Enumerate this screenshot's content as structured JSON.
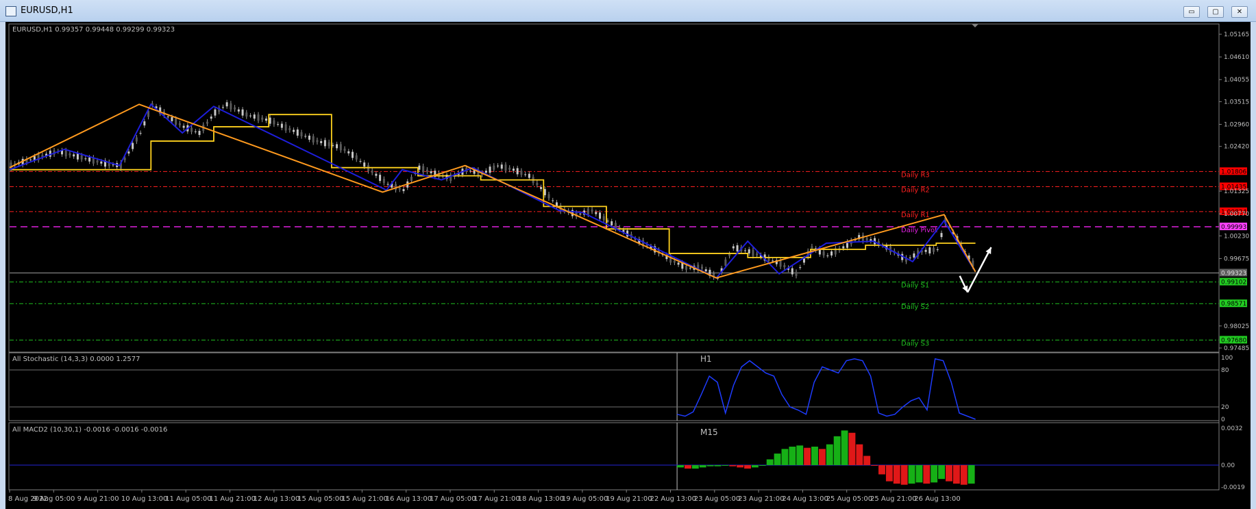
{
  "window": {
    "title": "EURUSD,H1",
    "buttons": {
      "minimize": "▭",
      "restore": "▢",
      "close": "✕"
    }
  },
  "main_header": "EURUSD,H1  0.99357 0.99448 0.99299 0.99323",
  "stoch_header": "All Stochastic (14,3,3) 0.0000 1.2577",
  "macd_header": "All MACD2 (10,30,1) -0.0016 -0.0016 -0.0016",
  "stoch_tf": "H1",
  "macd_tf": "M15",
  "colors": {
    "background": "#000000",
    "zigzag_blue": "#1e1edc",
    "zigzag_orange": "#ff9a1e",
    "step_yellow": "#ffd21e",
    "resistance": "#ff2020",
    "support": "#20c020",
    "pivot": "#e020e0",
    "stoch": "#1e3cff",
    "macd_up": "#16b016",
    "macd_down": "#e01818",
    "arrow": "#ffffff"
  },
  "chart_data": [
    {
      "type": "line",
      "symbol": "EURUSD",
      "timeframe": "H1",
      "ylim": [
        0.97485,
        1.05165
      ],
      "y_ticks": [
        "1.05165",
        "1.04610",
        "1.04055",
        "1.03515",
        "1.02960",
        "1.02420",
        "1.01325",
        "1.00770",
        "1.00230",
        "0.99675",
        "0.98025",
        "0.97485"
      ],
      "x_ticks": [
        "8 Aug 2022",
        "9 Aug 05:00",
        "9 Aug 21:00",
        "10 Aug 13:00",
        "11 Aug 05:00",
        "11 Aug 21:00",
        "12 Aug 13:00",
        "15 Aug 05:00",
        "15 Aug 21:00",
        "16 Aug 13:00",
        "17 Aug 05:00",
        "17 Aug 21:00",
        "18 Aug 13:00",
        "19 Aug 05:00",
        "19 Aug 21:00",
        "22 Aug 13:00",
        "23 Aug 05:00",
        "23 Aug 21:00",
        "24 Aug 13:00",
        "25 Aug 05:00",
        "25 Aug 21:00",
        "26 Aug 13:00"
      ],
      "levels": [
        {
          "name": "Daily R3",
          "value": 1.01806,
          "label": "1.01806",
          "kind": "resistance"
        },
        {
          "name": "Daily R2",
          "value": 1.01435,
          "label": "1.01435",
          "kind": "resistance"
        },
        {
          "name": "Daily R1",
          "value": 1.00824,
          "label": "1.00824",
          "kind": "resistance"
        },
        {
          "name": "Daily Pivot",
          "value": 1.00453,
          "label": "0.99993",
          "kind": "pivot"
        },
        {
          "name": "",
          "value": 0.99323,
          "label": "0.99323",
          "kind": "current"
        },
        {
          "name": "Daily S1",
          "value": 0.99102,
          "label": "0.99102",
          "kind": "support"
        },
        {
          "name": "Daily S2",
          "value": 0.98571,
          "label": "0.98571",
          "kind": "support"
        },
        {
          "name": "Daily S3",
          "value": 0.9768,
          "label": "0.97680",
          "kind": "support"
        }
      ],
      "price_path": [
        [
          0,
          1.0195
        ],
        [
          5,
          1.021
        ],
        [
          12,
          1.023
        ],
        [
          18,
          1.0215
        ],
        [
          24,
          1.02
        ],
        [
          28,
          1.0195
        ],
        [
          33,
          1.0275
        ],
        [
          36,
          1.0345
        ],
        [
          40,
          1.0315
        ],
        [
          44,
          1.029
        ],
        [
          48,
          1.0275
        ],
        [
          52,
          1.0325
        ],
        [
          55,
          1.0345
        ],
        [
          60,
          1.032
        ],
        [
          66,
          1.0305
        ],
        [
          72,
          1.028
        ],
        [
          78,
          1.0255
        ],
        [
          84,
          1.024
        ],
        [
          88,
          1.0215
        ],
        [
          92,
          1.018
        ],
        [
          96,
          1.015
        ],
        [
          100,
          1.0135
        ],
        [
          104,
          1.019
        ],
        [
          108,
          1.0175
        ],
        [
          112,
          1.0165
        ],
        [
          116,
          1.0185
        ],
        [
          120,
          1.0175
        ],
        [
          124,
          1.0195
        ],
        [
          128,
          1.0185
        ],
        [
          132,
          1.017
        ],
        [
          136,
          1.013
        ],
        [
          140,
          1.009
        ],
        [
          144,
          1.0075
        ],
        [
          148,
          1.0085
        ],
        [
          152,
          1.006
        ],
        [
          156,
          1.0035
        ],
        [
          160,
          1.001
        ],
        [
          164,
          0.999
        ],
        [
          168,
          0.9965
        ],
        [
          172,
          0.9945
        ],
        [
          176,
          0.9945
        ],
        [
          180,
          0.992
        ],
        [
          184,
          0.9995
        ],
        [
          188,
          0.9985
        ],
        [
          192,
          0.997
        ],
        [
          196,
          0.9955
        ],
        [
          200,
          0.993
        ],
        [
          204,
          0.9995
        ],
        [
          208,
          0.9975
        ],
        [
          212,
          0.9995
        ],
        [
          216,
          1.002
        ],
        [
          220,
          1.001
        ],
        [
          224,
          0.999
        ],
        [
          228,
          0.9965
        ],
        [
          232,
          0.9985
        ],
        [
          236,
          0.999
        ],
        [
          238,
          1.006
        ],
        [
          240,
          1.003
        ],
        [
          243,
          0.9985
        ],
        [
          246,
          0.994
        ]
      ],
      "zigzag_orange": [
        [
          0,
          1.019
        ],
        [
          33,
          1.0345
        ],
        [
          95,
          1.013
        ],
        [
          116,
          1.0195
        ],
        [
          180,
          0.992
        ],
        [
          238,
          1.0075
        ],
        [
          246,
          0.9935
        ]
      ],
      "zigzag_blue": [
        [
          0,
          1.0185
        ],
        [
          14,
          1.0235
        ],
        [
          28,
          1.0195
        ],
        [
          36,
          1.0345
        ],
        [
          44,
          1.0275
        ],
        [
          52,
          1.034
        ],
        [
          96,
          1.0135
        ],
        [
          100,
          1.0185
        ],
        [
          110,
          1.016
        ],
        [
          118,
          1.019
        ],
        [
          140,
          1.0085
        ],
        [
          146,
          1.008
        ],
        [
          180,
          0.992
        ],
        [
          188,
          1.001
        ],
        [
          196,
          0.993
        ],
        [
          208,
          1.0005
        ],
        [
          220,
          1.001
        ],
        [
          230,
          0.996
        ],
        [
          238,
          1.006
        ],
        [
          246,
          0.9935
        ]
      ],
      "step_yellow": [
        [
          0,
          1.0185
        ],
        [
          36,
          1.0185
        ],
        [
          36,
          1.0255
        ],
        [
          52,
          1.0255
        ],
        [
          52,
          1.029
        ],
        [
          66,
          1.029
        ],
        [
          66,
          1.032
        ],
        [
          82,
          1.032
        ],
        [
          82,
          1.019
        ],
        [
          104,
          1.019
        ],
        [
          104,
          1.017
        ],
        [
          120,
          1.017
        ],
        [
          120,
          1.016
        ],
        [
          136,
          1.016
        ],
        [
          136,
          1.0095
        ],
        [
          152,
          1.0095
        ],
        [
          152,
          1.004
        ],
        [
          168,
          1.004
        ],
        [
          168,
          0.998
        ],
        [
          188,
          0.998
        ],
        [
          188,
          0.997
        ],
        [
          204,
          0.997
        ],
        [
          204,
          0.999
        ],
        [
          218,
          0.999
        ],
        [
          218,
          1.0
        ],
        [
          236,
          1.0
        ],
        [
          236,
          1.0005
        ],
        [
          246,
          1.0005
        ]
      ],
      "forecast_arrows": [
        {
          "from": [
            242,
            0.9925
          ],
          "to": [
            244,
            0.9885
          ]
        },
        {
          "from": [
            244,
            0.9885
          ],
          "to": [
            250,
            0.9995
          ]
        }
      ]
    },
    {
      "type": "line",
      "name": "All Stochastic (14,3,3)",
      "ylim": [
        0,
        100
      ],
      "y_ticks": [
        "100",
        "80",
        "20",
        "0"
      ],
      "timeframe_label": "H1",
      "x_range": [
        170,
        246
      ],
      "values": [
        8,
        5,
        12,
        40,
        70,
        60,
        10,
        55,
        85,
        95,
        85,
        75,
        70,
        40,
        20,
        15,
        8,
        60,
        85,
        80,
        75,
        95,
        98,
        95,
        70,
        10,
        5,
        8,
        20,
        30,
        35,
        15,
        98,
        95,
        60,
        10,
        5,
        0
      ]
    },
    {
      "type": "bar",
      "name": "All MACD2 (10,30,1)",
      "ylim": [
        -0.0019,
        0.0032
      ],
      "y_ticks": [
        "0.0032",
        "0.00",
        "-0.0019"
      ],
      "timeframe_label": "M15",
      "x_range": [
        170,
        246
      ],
      "values": [
        -0.0002,
        -0.0003,
        -0.0003,
        -0.0002,
        -0.0001,
        -0.0001,
        0.0,
        -0.0001,
        -0.0002,
        -0.0003,
        -0.0002,
        0.0,
        0.0005,
        0.001,
        0.0014,
        0.0016,
        0.0017,
        0.0015,
        0.0016,
        0.0014,
        0.0018,
        0.0025,
        0.003,
        0.0028,
        0.0018,
        0.0008,
        0.0,
        -0.0008,
        -0.0014,
        -0.0016,
        -0.0017,
        -0.0016,
        -0.0015,
        -0.0016,
        -0.0015,
        -0.0012,
        -0.0014,
        -0.0016,
        -0.0017,
        -0.0016
      ]
    }
  ]
}
